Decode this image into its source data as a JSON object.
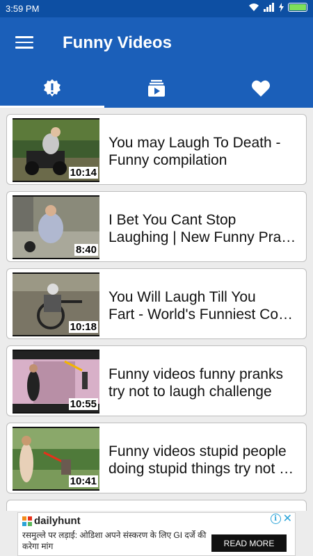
{
  "status_bar": {
    "time": "3:59 PM",
    "battery_level": 1.0
  },
  "app_bar": {
    "title": "Funny Videos",
    "menu_icon": "hamburger-menu-icon"
  },
  "tabs": [
    {
      "icon": "alert-badge-icon",
      "active": true
    },
    {
      "icon": "video-playlist-icon",
      "active": false
    },
    {
      "icon": "heart-icon",
      "active": false
    }
  ],
  "videos": [
    {
      "title_line1": "You may Laugh To Death -",
      "title_line2": "Funny compilation",
      "duration": "10:14"
    },
    {
      "title_line1": "I Bet You Cant Stop",
      "title_line2": "Laughing | New Funny Pran…",
      "duration": "8:40"
    },
    {
      "title_line1": "You Will Laugh Till You",
      "title_line2": "Fart - World's Funniest Co…",
      "duration": "10:18"
    },
    {
      "title_line1": "Funny videos funny pranks",
      "title_line2": "try not to laugh challenge",
      "duration": "10:55"
    },
    {
      "title_line1": "Funny videos stupid people",
      "title_line2": "doing stupid things try not …",
      "duration": "10:41"
    }
  ],
  "ad": {
    "brand": "dailyhunt",
    "text": "रसमुल्ले पर लड़ाई: ओडिशा अपने संस्करण के लिए GI दर्जे की करेगा मांग",
    "button": "READ MORE"
  },
  "colors": {
    "status_bar": "#0d4fa3",
    "app_bar": "#1b5fb9",
    "background": "#ececec",
    "ad_accent": "#2aa3d8"
  }
}
